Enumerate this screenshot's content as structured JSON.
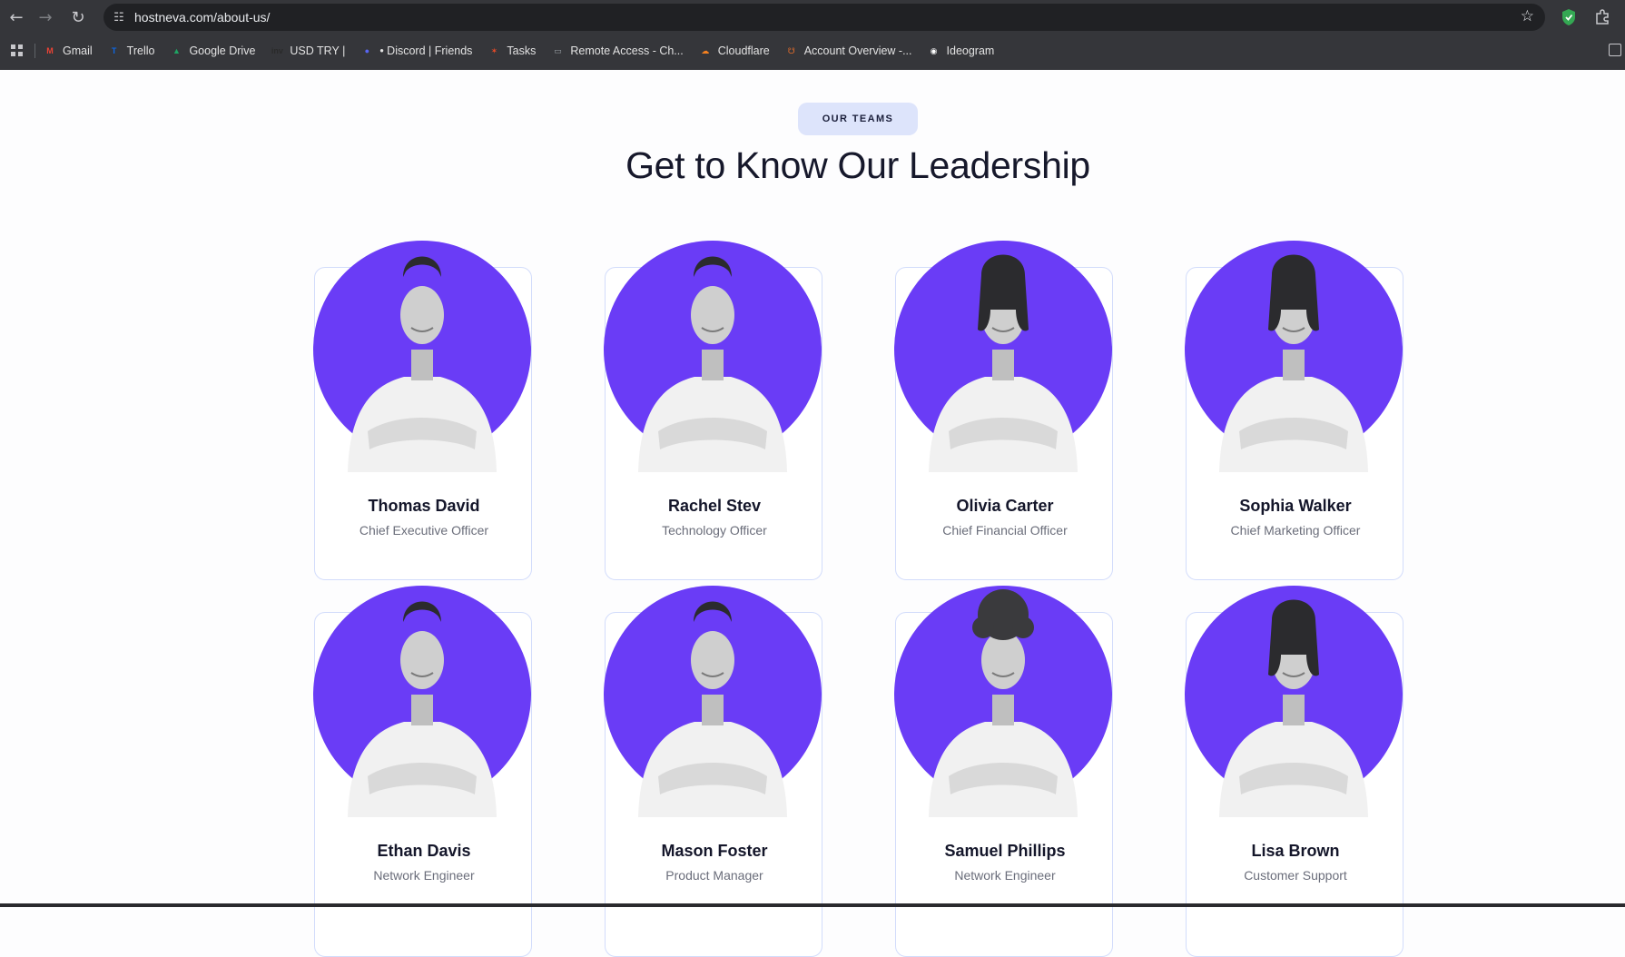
{
  "browser": {
    "url": "hostneva.com/about-us/",
    "bookmarks": [
      {
        "label": "Gmail",
        "color": "#ea4335",
        "glyph": "M"
      },
      {
        "label": "Trello",
        "color": "#0c66e4",
        "glyph": "T"
      },
      {
        "label": "Google Drive",
        "color": "#1fa463",
        "glyph": "▲"
      },
      {
        "label": "USD TRY |",
        "color": "#2a2a2a",
        "glyph": "inv"
      },
      {
        "label": "• Discord | Friends",
        "color": "#5865f2",
        "glyph": "●"
      },
      {
        "label": "Tasks",
        "color": "#e84a27",
        "glyph": "✶"
      },
      {
        "label": "Remote Access - Ch...",
        "color": "#9aa0a6",
        "glyph": "▭"
      },
      {
        "label": "Cloudflare",
        "color": "#f38020",
        "glyph": "☁"
      },
      {
        "label": "Account Overview -...",
        "color": "#e06c2b",
        "glyph": "☋"
      },
      {
        "label": "Ideogram",
        "color": "#ffffff",
        "glyph": "◉"
      }
    ]
  },
  "section": {
    "badge": "OUR TEAMS",
    "title": "Get to Know Our Leadership"
  },
  "team": [
    {
      "name": "Thomas David",
      "role": "Chief Executive Officer",
      "hair": "short"
    },
    {
      "name": "Rachel Stev",
      "role": "Technology Officer",
      "hair": "short"
    },
    {
      "name": "Olivia Carter",
      "role": "Chief Financial Officer",
      "hair": "long"
    },
    {
      "name": "Sophia Walker",
      "role": "Chief Marketing Officer",
      "hair": "long"
    },
    {
      "name": "Ethan Davis",
      "role": "Network Engineer",
      "hair": "short"
    },
    {
      "name": "Mason Foster",
      "role": "Product Manager",
      "hair": "short"
    },
    {
      "name": "Samuel Phillips",
      "role": "Network Engineer",
      "hair": "curly"
    },
    {
      "name": "Lisa Brown",
      "role": "Customer Support",
      "hair": "long"
    }
  ],
  "colors": {
    "accent": "#6a3cf6",
    "card_border": "#d2dcfb",
    "badge_bg": "#dde4fb"
  }
}
